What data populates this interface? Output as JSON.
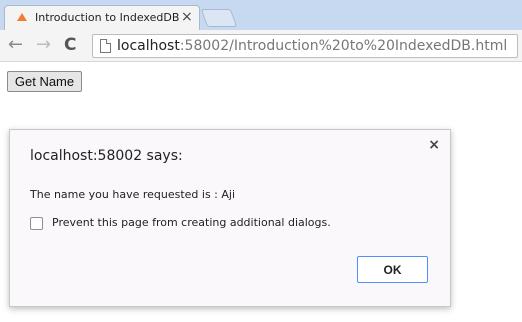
{
  "browser": {
    "tab": {
      "title": "Introduction to IndexedDB",
      "close": "×",
      "icon": "html5-icon"
    },
    "nav": {
      "back": "←",
      "forward": "→",
      "reload": "C"
    },
    "address": {
      "host": "localhost",
      "path": ":58002/Introduction%20to%20IndexedDB.html"
    }
  },
  "page": {
    "button_label": "Get Name"
  },
  "dialog": {
    "title": "localhost:58002 says:",
    "close": "×",
    "message": "The name you have requested is : Aji",
    "checkbox_label": "Prevent this page from creating additional dialogs.",
    "checkbox_checked": false,
    "ok_label": "OK"
  }
}
